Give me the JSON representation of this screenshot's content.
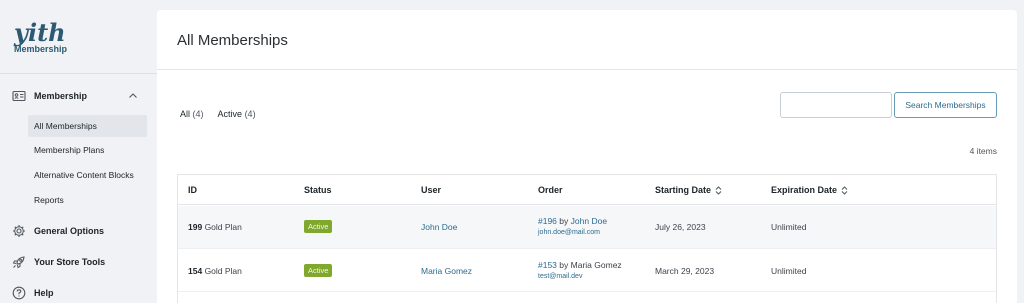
{
  "brand": {
    "logo_text": "yith",
    "subtitle": "Membership",
    "accent": "#2c5a73"
  },
  "sidebar": {
    "items": [
      {
        "label": "Membership",
        "icon": "id-card-icon",
        "expanded": true
      },
      {
        "label": "General Options",
        "icon": "gear-icon"
      },
      {
        "label": "Your Store Tools",
        "icon": "rocket-icon"
      },
      {
        "label": "Help",
        "icon": "question-circle-icon"
      }
    ],
    "subitems": [
      {
        "label": "All Memberships",
        "active": true
      },
      {
        "label": "Membership Plans"
      },
      {
        "label": "Alternative Content Blocks"
      },
      {
        "label": "Reports"
      }
    ]
  },
  "main": {
    "title": "All Memberships",
    "filters": [
      {
        "label": "All",
        "count": "(4)"
      },
      {
        "label": "Active",
        "count": "(4)"
      }
    ],
    "search": {
      "value": "",
      "button_label": "Search Memberships"
    },
    "items_count": "4 items",
    "table": {
      "columns": [
        "ID",
        "Status",
        "User",
        "Order",
        "Starting Date",
        "Expiration Date"
      ],
      "rows": [
        {
          "id": "199",
          "plan": "Gold Plan",
          "status": "Active",
          "user": "John Doe",
          "order_number": "#196",
          "order_by": "by",
          "order_user": "John Doe",
          "order_email": "john.doe@mail.com",
          "start": "July 26, 2023",
          "expiration": "Unlimited"
        },
        {
          "id": "154",
          "plan": "Gold Plan",
          "status": "Active",
          "user": "Maria Gomez",
          "order_number": "#153",
          "order_by": "by",
          "order_user": "Maria Gomez",
          "order_email": "test@mail.dev",
          "start": "March 29, 2023",
          "expiration": "Unlimited"
        }
      ]
    }
  },
  "colors": {
    "status_active": "#7fa82c",
    "link": "#2c6b8f"
  }
}
